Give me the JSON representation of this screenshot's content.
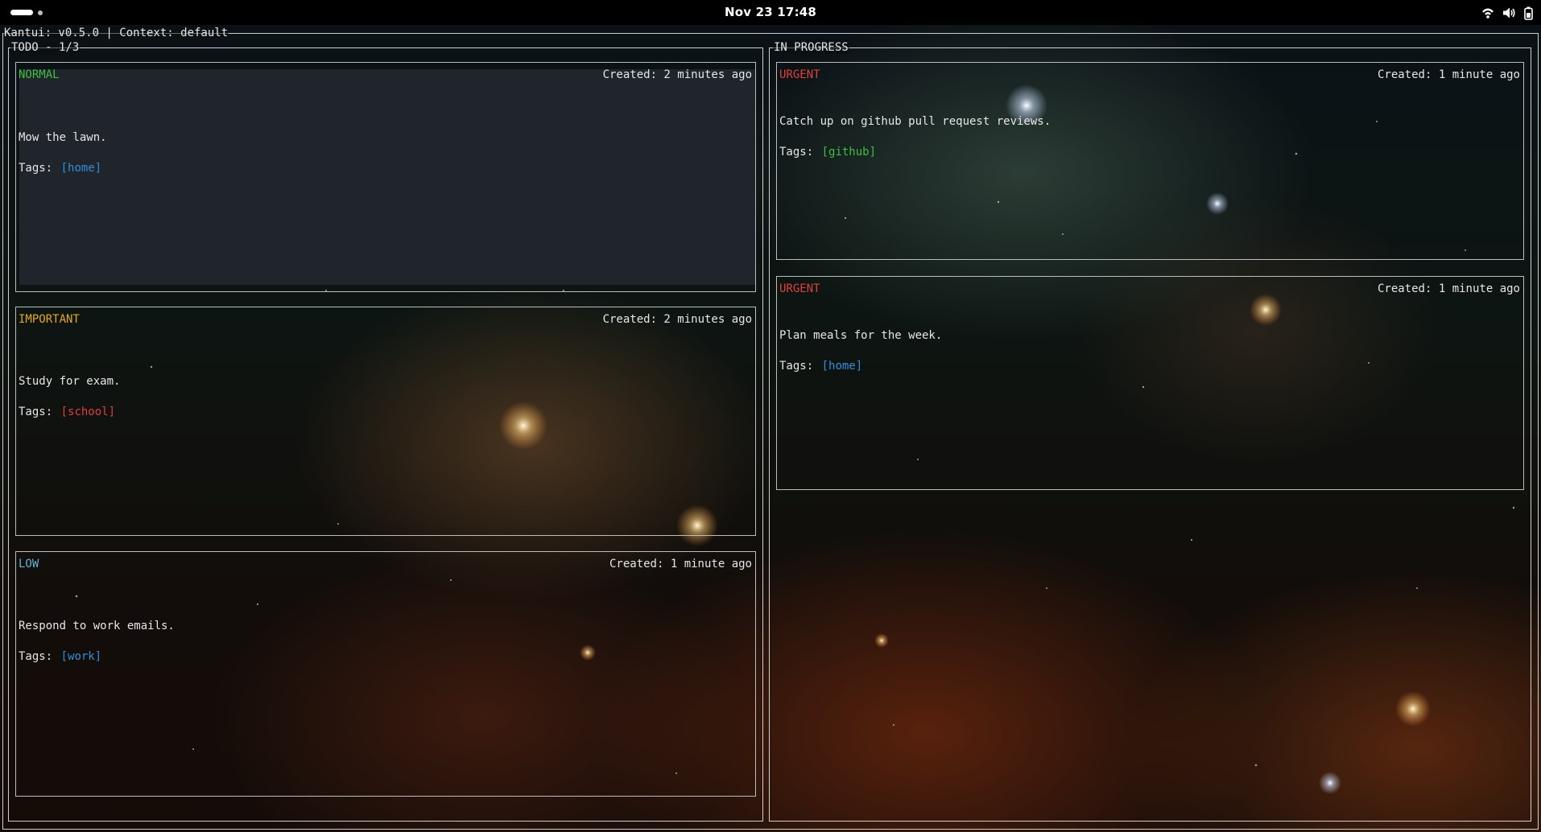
{
  "system_bar": {
    "datetime": "Nov 23  17:48",
    "icons": [
      "wifi-icon",
      "volume-icon",
      "battery-icon"
    ]
  },
  "app": {
    "title": "Kantui: v0.5.0 | Context: default"
  },
  "columns": {
    "todo": {
      "title": "TODO - 1/3",
      "cards": [
        {
          "priority": "NORMAL",
          "priority_color": "#3fbf3f",
          "created": "Created: 2 minutes ago",
          "description": "Mow the lawn.",
          "tags_label": "Tags:",
          "tags": "[home]",
          "tag_color": "#2e8fe0",
          "selected": true
        },
        {
          "priority": "IMPORTANT",
          "priority_color": "#e6a817",
          "created": "Created: 2 minutes ago",
          "description": "Study for exam.",
          "tags_label": "Tags:",
          "tags": "[school]",
          "tag_color": "#e0403c",
          "selected": false
        },
        {
          "priority": "LOW",
          "priority_color": "#5fb6d8",
          "created": "Created: 1 minute ago",
          "description": "Respond to work emails.",
          "tags_label": "Tags:",
          "tags": "[work]",
          "tag_color": "#2e8fe0",
          "selected": false
        }
      ]
    },
    "in_progress": {
      "title": "IN PROGRESS",
      "cards": [
        {
          "priority": "URGENT",
          "priority_color": "#e0403c",
          "created": "Created: 1 minute ago",
          "description": "Catch up on github pull request reviews.",
          "tags_label": "Tags:",
          "tags": "[github]",
          "tag_color": "#3fbf3f",
          "selected": false
        },
        {
          "priority": "URGENT",
          "priority_color": "#e0403c",
          "created": "Created: 1 minute ago",
          "description": "Plan meals for the week.",
          "tags_label": "Tags:",
          "tags": "[home]",
          "tag_color": "#2e8fe0",
          "selected": false
        }
      ]
    }
  }
}
